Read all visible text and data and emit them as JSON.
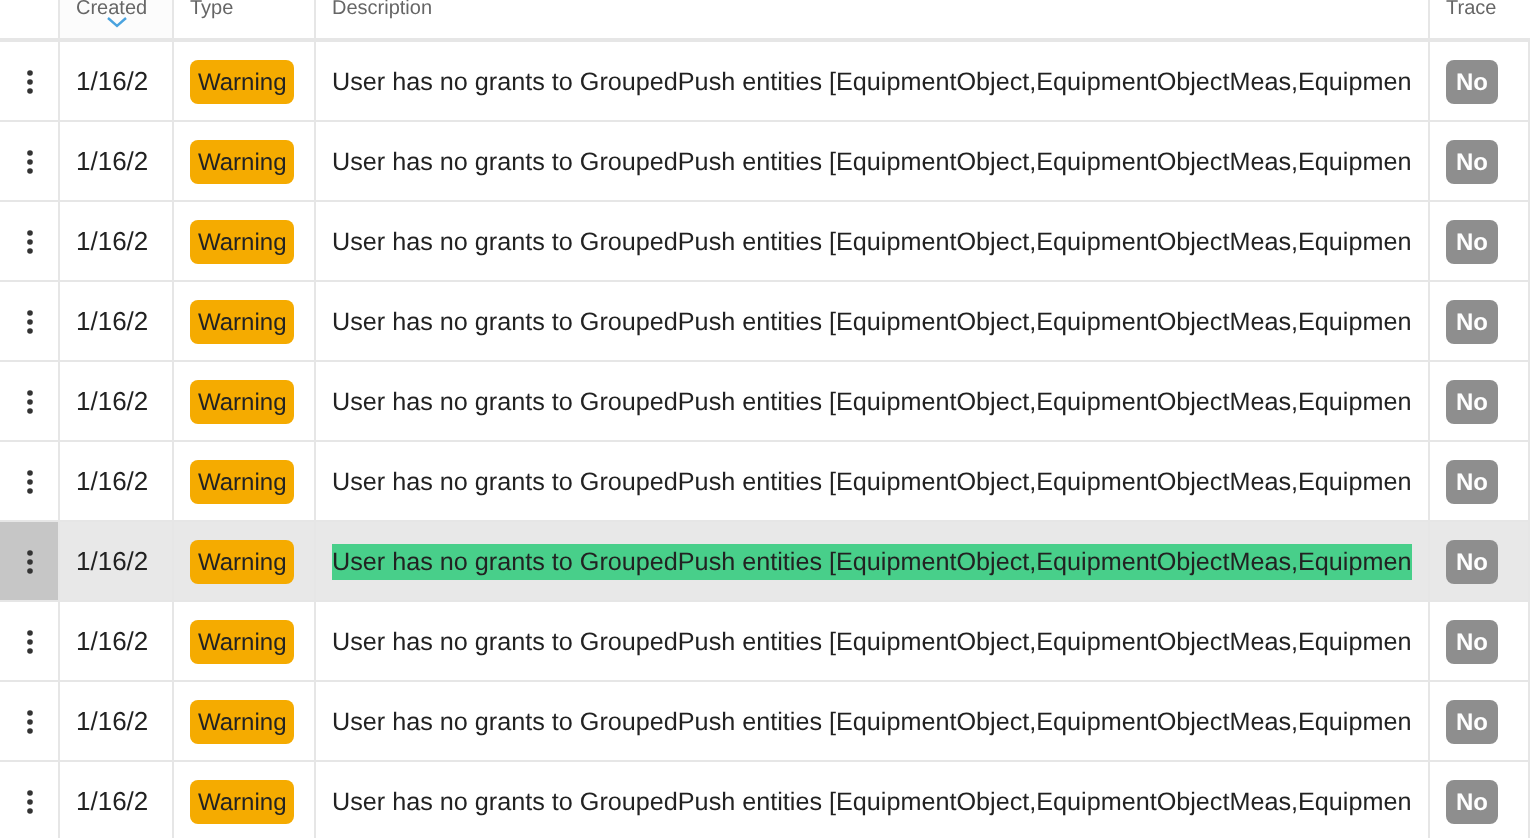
{
  "table": {
    "columns": [
      {
        "sorted": false
      },
      {
        "label": "Created",
        "sorted": true
      },
      {
        "label": "Type",
        "sorted": false
      },
      {
        "label": "Description",
        "sorted": false
      },
      {
        "label": "Trace",
        "sorted": false
      }
    ],
    "rows": [
      {
        "created": "1/16/2",
        "type": "Warning",
        "description": "User has no grants to GroupedPush entities [EquipmentObject,EquipmentObjectMeas,Equipmen",
        "trace": "No",
        "selected": false
      },
      {
        "created": "1/16/2",
        "type": "Warning",
        "description": "User has no grants to GroupedPush entities [EquipmentObject,EquipmentObjectMeas,Equipmen",
        "trace": "No",
        "selected": false
      },
      {
        "created": "1/16/2",
        "type": "Warning",
        "description": "User has no grants to GroupedPush entities [EquipmentObject,EquipmentObjectMeas,Equipmen",
        "trace": "No",
        "selected": false
      },
      {
        "created": "1/16/2",
        "type": "Warning",
        "description": "User has no grants to GroupedPush entities [EquipmentObject,EquipmentObjectMeas,Equipmen",
        "trace": "No",
        "selected": false
      },
      {
        "created": "1/16/2",
        "type": "Warning",
        "description": "User has no grants to GroupedPush entities [EquipmentObject,EquipmentObjectMeas,Equipmen",
        "trace": "No",
        "selected": false
      },
      {
        "created": "1/16/2",
        "type": "Warning",
        "description": "User has no grants to GroupedPush entities [EquipmentObject,EquipmentObjectMeas,Equipmen",
        "trace": "No",
        "selected": false
      },
      {
        "created": "1/16/2",
        "type": "Warning",
        "description": "User has no grants to GroupedPush entities [EquipmentObject,EquipmentObjectMeas,Equipmen",
        "trace": "No",
        "selected": true
      },
      {
        "created": "1/16/2",
        "type": "Warning",
        "description": "User has no grants to GroupedPush entities [EquipmentObject,EquipmentObjectMeas,Equipmen",
        "trace": "No",
        "selected": false
      },
      {
        "created": "1/16/2",
        "type": "Warning",
        "description": "User has no grants to GroupedPush entities [EquipmentObject,EquipmentObjectMeas,Equipmen",
        "trace": "No",
        "selected": false
      },
      {
        "created": "1/16/2",
        "type": "Warning",
        "description": "User has no grants to GroupedPush entities [EquipmentObject,EquipmentObjectMeas,Equipmen",
        "trace": "No",
        "selected": false
      }
    ]
  }
}
